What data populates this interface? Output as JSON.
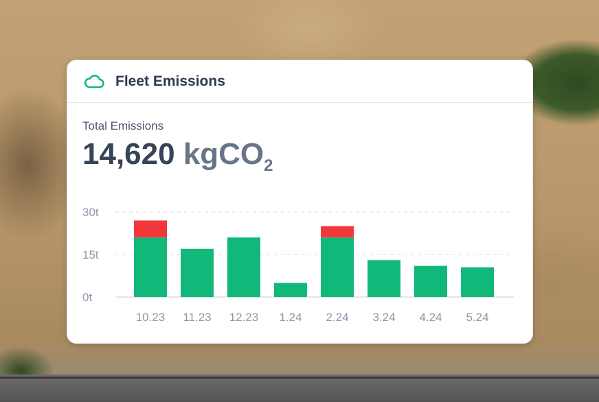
{
  "card": {
    "title": "Fleet Emissions",
    "icon": "cloud-icon"
  },
  "summary": {
    "label": "Total Emissions",
    "value": "14,620",
    "unit": "kgCO",
    "unit_subscript": "2"
  },
  "colors": {
    "base": "#12b87a",
    "excess": "#f2383a",
    "grid": "#d9dde3",
    "tick": "#8c97a8"
  },
  "chart_data": {
    "type": "bar",
    "stacked": true,
    "categories": [
      "10.23",
      "11.23",
      "12.23",
      "1.24",
      "2.24",
      "3.24",
      "4.24",
      "5.24"
    ],
    "series": [
      {
        "values": [
          21,
          17,
          21,
          5,
          21,
          13,
          11,
          10.5
        ]
      },
      {
        "values": [
          6,
          0,
          0,
          0,
          4,
          0,
          0,
          0
        ]
      }
    ],
    "yticks": [
      {
        "value": 0,
        "label": "0t"
      },
      {
        "value": 15,
        "label": "15t"
      },
      {
        "value": 30,
        "label": "30t"
      }
    ],
    "ylim": [
      0,
      30
    ],
    "grid": true
  }
}
